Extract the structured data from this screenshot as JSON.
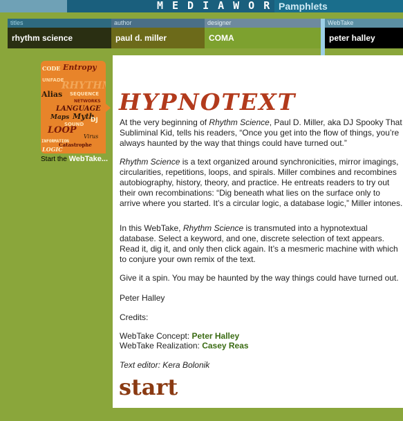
{
  "banner": {
    "brand": "MEDIAWORK",
    "section": "Pamphlets"
  },
  "header": {
    "titles_label": "titles",
    "titles_value": "rhythm science",
    "author_label": "author",
    "author_value": "paul d. miller",
    "designer_label": "designer",
    "designer_value": "COMA",
    "webtake_label": "WebTake",
    "webtake_value": "peter halley"
  },
  "thumbnail": {
    "words": [
      "CODE",
      "Entropy",
      "UNFADE",
      "RHYTHM",
      "Alias",
      "SEQUENCE",
      "NETWORKS",
      "LANGUAGE",
      "Maps",
      "Myth",
      "DJ",
      "SOUND",
      "LOOP",
      "Virus",
      "INFORMATION",
      "Catastrophe",
      "LOGIC"
    ],
    "hint_prefix": "Start the",
    "hint_link": "WebTake..."
  },
  "content": {
    "title": "HYPNOTEXT",
    "p1_a": "At the very beginning of ",
    "p1_em": "Rhythm Science",
    "p1_b": ", Paul D. Miller, aka DJ Spooky That Subliminal Kid, tells his readers, “Once you get into the flow of things, you’re always haunted by the way that things could have turned out.”",
    "p2_em": "Rhythm Science",
    "p2_b": " is a text organized around synchronicities, mirror imagings, circularities, repetitions, loops, and spirals. Miller combines and recombines autobiography, history, theory, and practice. He entreats readers to try out their own recombinations: “Dig beneath what lies on the surface only to arrive where you started. It’s a circular logic, a database logic,” Miller intones.",
    "p3_a": "In this WebTake, ",
    "p3_em": "Rhythm Science",
    "p3_b": " is transmuted into a hypnotextual database. Select a keyword, and one, discrete selection of text appears. Read it, dig it, and only then click again. It’s a mesmeric machine with which to conjure your own remix of the text.",
    "p4": "Give it a spin. You may be haunted by the way things could have turned out.",
    "signature": "Peter Halley",
    "credits_label": "Credits:",
    "concept_label": "WebTake Concept: ",
    "concept_name": "Peter Halley",
    "realization_label": "WebTake Realization: ",
    "realization_name": "Casey Reas",
    "editor": "Text editor: Kera Bolonik",
    "start": "start"
  },
  "colors": {
    "background": "#8aa63b",
    "title_red": "#b23a1c",
    "start_brown": "#8a3a12",
    "credit_green": "#3a6b12",
    "thumb_orange": "#e8842a"
  }
}
